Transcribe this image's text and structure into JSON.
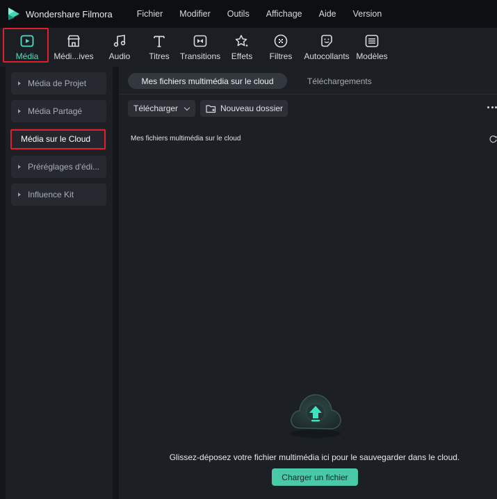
{
  "app": {
    "title": "Wondershare Filmora",
    "logo_icon": "filmora-logo-icon"
  },
  "menu": [
    {
      "id": "fichier",
      "label": "Fichier"
    },
    {
      "id": "modifier",
      "label": "Modifier"
    },
    {
      "id": "outils",
      "label": "Outils"
    },
    {
      "id": "affichage",
      "label": "Affichage"
    },
    {
      "id": "aide",
      "label": "Aide"
    },
    {
      "id": "version",
      "label": "Version"
    }
  ],
  "toolbar": {
    "media": "Média",
    "stock_media": "Médi...ives",
    "audio": "Audio",
    "titres": "Titres",
    "transitions": "Transitions",
    "effets": "Effets",
    "filtres": "Filtres",
    "autocollants": "Autocollants",
    "modeles": "Modèles"
  },
  "sidebar": {
    "items": [
      {
        "label": "Média de Projet"
      },
      {
        "label": "Média Partagé"
      },
      {
        "label": "Média sur le Cloud"
      },
      {
        "label": "Préréglages d'édi..."
      },
      {
        "label": "Influence Kit"
      }
    ],
    "selected_index": 2
  },
  "tabs": {
    "cloud": "Mes fichiers multimédia sur le cloud",
    "downloads": "Téléchargements"
  },
  "actions": {
    "upload": "Télécharger",
    "new_folder": "Nouveau dossier"
  },
  "content": {
    "section_title": "Mes fichiers multimédia sur le cloud",
    "drop_message": "Glissez-déposez votre fichier multimédia ici pour le sauvegarder dans le cloud.",
    "upload_button": "Charger un fichier"
  },
  "colors": {
    "accent": "#4ee0c3",
    "button_accent": "#49c9a8",
    "highlight": "#e0202b"
  }
}
